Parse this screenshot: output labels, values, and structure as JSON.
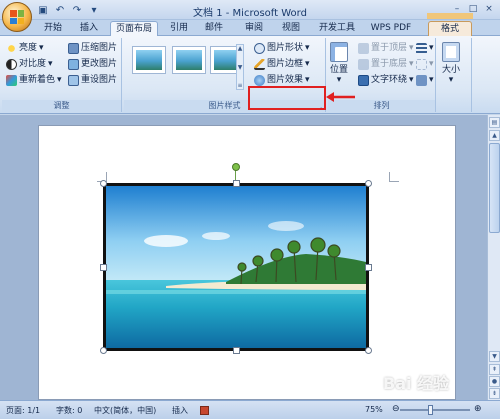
{
  "window": {
    "title": "文档 1 - Microsoft Word",
    "controls": [
      "–",
      "□",
      "×"
    ]
  },
  "qat": [
    "save-icon",
    "undo-icon",
    "redo-icon",
    "customize-icon"
  ],
  "tabs": [
    {
      "label": "开始"
    },
    {
      "label": "插入"
    },
    {
      "label": "页面布局"
    },
    {
      "label": "引用"
    },
    {
      "label": "邮件"
    },
    {
      "label": "审阅"
    },
    {
      "label": "视图"
    },
    {
      "label": "开发工具"
    },
    {
      "label": "WPS PDF"
    },
    {
      "label": "格式"
    }
  ],
  "ribbon": {
    "adjust": {
      "label": "调整",
      "brightness": "亮度",
      "contrast": "对比度",
      "recolor": "重新着色",
      "compress": "压缩图片",
      "change": "更改图片",
      "reset": "重设图片"
    },
    "styles": {
      "label": "图片样式",
      "shape": "图片形状",
      "border": "图片边框",
      "effects": "图片效果"
    },
    "arrange": {
      "label": "排列",
      "position": "位置",
      "bring_front": "置于顶层",
      "send_back": "置于底层",
      "text_wrap": "文字环绕"
    },
    "size": {
      "label": "大小"
    }
  },
  "status": {
    "page": "页面: 1/1",
    "words": "字数: 0",
    "language": "中文(简体，中国)",
    "mode": "插入",
    "zoom": "75%"
  },
  "watermark": "Bai 经验",
  "colors": {
    "highlight": "#e02020",
    "ribbon_bg": "#dbe7f5",
    "format_tab": "#f6eadb"
  }
}
